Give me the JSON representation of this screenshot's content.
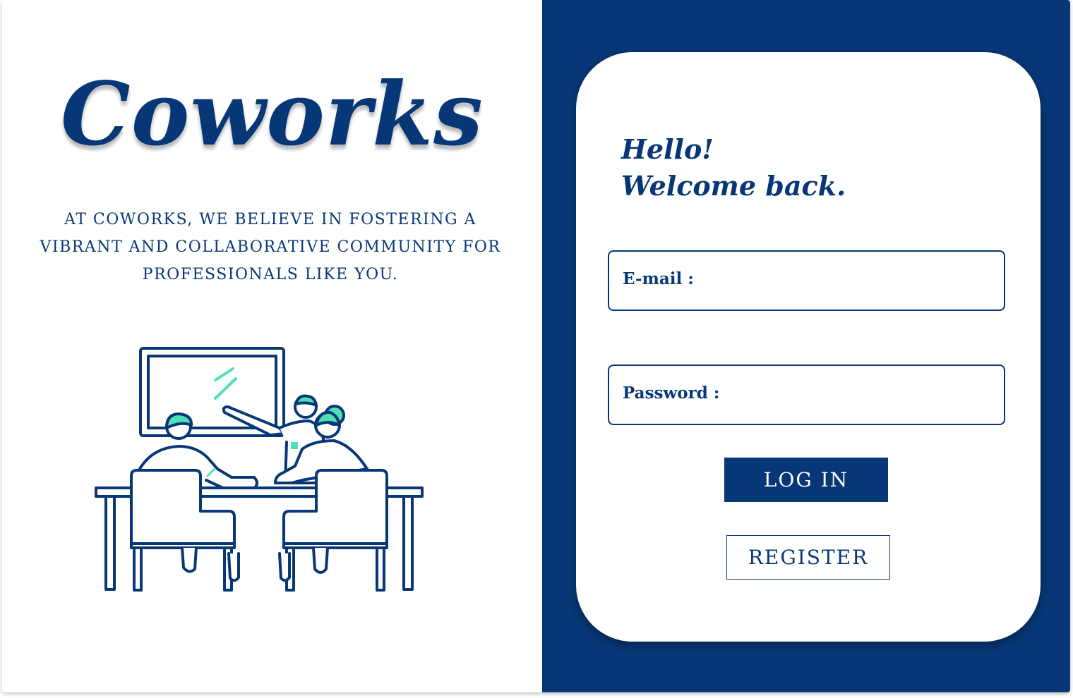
{
  "brand": {
    "name": "Coworks"
  },
  "tagline": "AT COWORKS, WE BELIEVE IN FOSTERING A VIBRANT AND COLLABORATIVE COMMUNITY FOR PROFESSIONALS LIKE YOU.",
  "login": {
    "greeting_line1": "Hello!",
    "greeting_line2": "Welcome back.",
    "email_label": "E-mail :",
    "email_value": "",
    "password_label": "Password :",
    "password_value": "",
    "login_button": "LOG IN",
    "register_button": "REGISTER"
  },
  "colors": {
    "primary": "#073776",
    "accent": "#4fe0b6",
    "background": "#ffffff"
  },
  "icons": {
    "illustration": "team-meeting-illustration"
  }
}
